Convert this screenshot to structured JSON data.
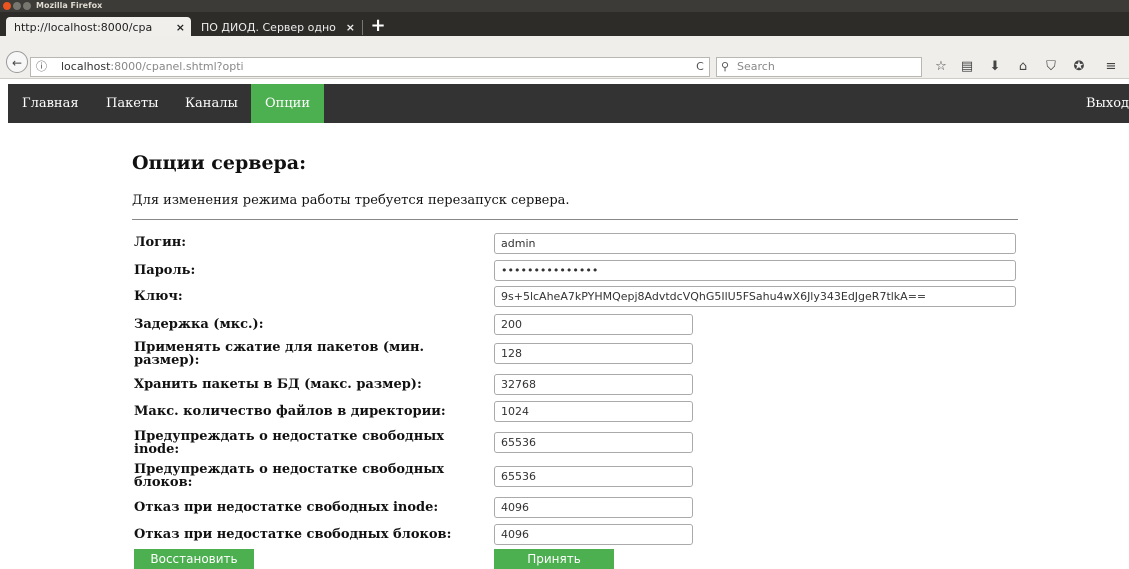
{
  "window": {
    "title": "Mozilla Firefox"
  },
  "tabs": [
    {
      "label": "http://localhost:8000/cpa",
      "close": "×"
    },
    {
      "label": "ПО ДИОД. Сервер одно",
      "close": "×"
    }
  ],
  "newtab": "+",
  "navbar": {
    "back": "←",
    "info": "ⓘ",
    "url_host": "localhost",
    "url_rest": ":8000/cpanel.shtml?opti",
    "reload": "C",
    "search_placeholder": "Search",
    "search_icon": "⚲",
    "icons": [
      "☆",
      "▤",
      "⬇",
      "⌂",
      "⛉",
      "✪",
      "≡"
    ]
  },
  "sitenav": {
    "items": [
      "Главная",
      "Пакеты",
      "Каналы",
      "Опции"
    ],
    "active": "Опции",
    "logout": "Выход"
  },
  "page": {
    "title": "Опции сервера:",
    "note": "Для изменения режима работы требуется перезапуск сервера."
  },
  "fields": [
    {
      "label": "Логин:",
      "value": "admin"
    },
    {
      "label": "Пароль:",
      "value": "•••••••••••••••"
    },
    {
      "label": "Ключ:",
      "value": "9s+5lcAheA7kPYHMQepj8AdvtdcVQhG5IlU5FSahu4wX6Jly343EdJgeR7tlkA=="
    },
    {
      "label": "Задержка (мкс.):",
      "value": "200"
    },
    {
      "label": "Применять сжатие для пакетов (мин. размер):",
      "value": "128"
    },
    {
      "label": "Хранить пакеты в БД (макс. размер):",
      "value": "32768"
    },
    {
      "label": "Макс. количество файлов в директории:",
      "value": "1024"
    },
    {
      "label": "Предупреждать о недостатке свободных inode:",
      "value": "65536"
    },
    {
      "label": "Предупреждать о недостатке свободных блоков:",
      "value": "65536"
    },
    {
      "label": "Отказ при недостатке свободных inode:",
      "value": "4096"
    },
    {
      "label": "Отказ при недостатке свободных блоков:",
      "value": "4096"
    }
  ],
  "buttons": {
    "restore": "Восстановить",
    "apply": "Принять"
  },
  "colors": {
    "accent": "#4caf50",
    "nav_bg": "#333333"
  }
}
